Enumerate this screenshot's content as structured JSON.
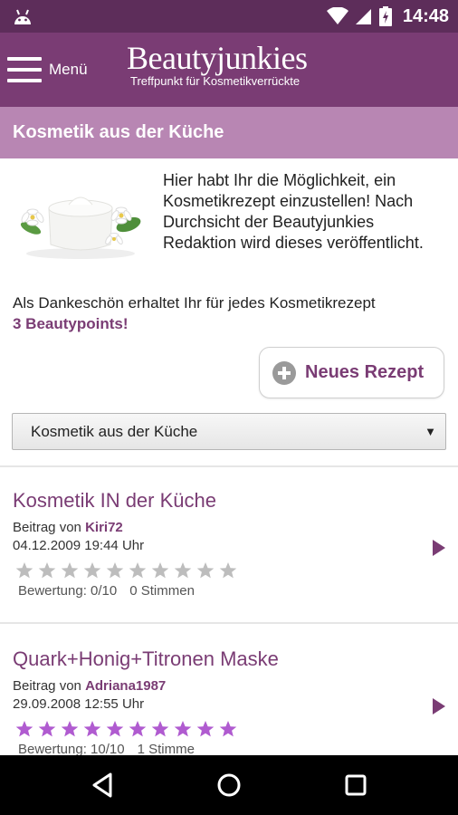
{
  "status_bar": {
    "time": "14:48",
    "icons": [
      "android-icon",
      "wifi-icon",
      "cell-signal-icon",
      "battery-icon"
    ]
  },
  "app_bar": {
    "menu_label": "Menü",
    "brand_name": "Beautyjunkies",
    "brand_tagline": "Treffpunkt für Kosmetikverrückte"
  },
  "page": {
    "title": "Kosmetik aus der Küche",
    "intro_text": "Hier habt Ihr die Möglichkeit, ein Kosmetikrezept einzustellen! Nach Durchsicht der Beautyjunkies Redaktion wird dieses veröffentlicht.",
    "thanks_text": "Als Dankeschön erhaltet Ihr für jedes Kosmetikrezept",
    "thanks_points": "3 Beautypoints!",
    "new_recipe_label": "Neues Rezept",
    "category_select": {
      "selected": "Kosmetik aus der Küche",
      "caret": "▼"
    }
  },
  "posts": [
    {
      "title": "Kosmetik IN der Küche",
      "author_prefix": "Beitrag von",
      "author": "Kiri72",
      "date": "04.12.2009 19:44 Uhr",
      "rating": 0,
      "rating_max": 10,
      "rating_label": "Bewertung: 0/10",
      "votes_label": "0 Stimmen"
    },
    {
      "title": "Quark+Honig+Titronen Maske",
      "author_prefix": "Beitrag von",
      "author": "Adriana1987",
      "date": "29.09.2008 12:55 Uhr",
      "rating": 10,
      "rating_max": 10,
      "rating_label": "Bewertung: 10/10",
      "votes_label": "1 Stimme"
    }
  ],
  "nav_bar": {
    "buttons": [
      "back-icon",
      "home-icon",
      "recents-icon"
    ]
  },
  "colors": {
    "status_bar": "#5d2d5a",
    "app_bar": "#7a3c74",
    "section_header": "#b886b3",
    "accent": "#7a3c74",
    "star_filled": "#b05bd0",
    "star_empty": "#bdbdbd"
  }
}
